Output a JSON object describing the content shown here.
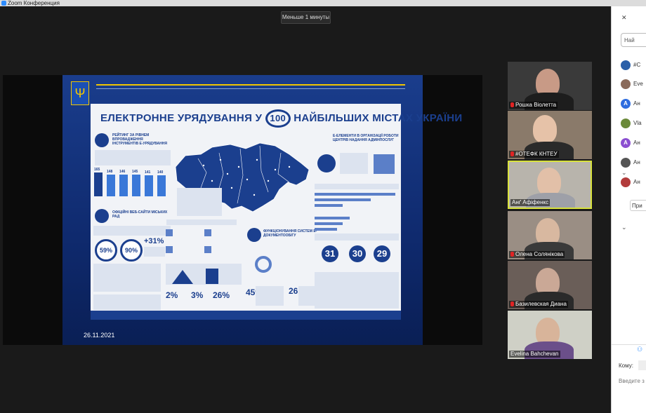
{
  "window": {
    "title": "Zoom Конференция"
  },
  "notice": {
    "label": "Меньше 1 минуты"
  },
  "slide": {
    "title_part1": "ЕЛЕКТРОННЕ УРЯДУВАННЯ У",
    "title_number": "100",
    "title_part2": "НАЙБІЛЬШИХ МІСТАХ УКРАЇНИ",
    "section1": "РЕЙТИНГ ЗА РІВНЕМ ВПРОВАДЖЕННЯ ІНСТРУМЕНТІВ Е-УРЯДУВАННЯ",
    "section2": "ОФІЦІЙНІ ВЕБ-САЙТИ МІСЬКИХ РАД",
    "section3": "ФУНКЦІОНУВАННЯ СИСТЕМ Е-ДОКУМЕНТООБІГУ",
    "section4": "Е-ЕЛЕМЕНТИ В ОРГАНІЗАЦІЇ РОБОТИ ЦЕНТРІВ НАДАННЯ АДМІНПОСЛУГ",
    "bars": [
      "165",
      "148",
      "146",
      "145",
      "141",
      "140"
    ],
    "pct1": "59%",
    "pct2": "90%",
    "pct3": "+31%",
    "stats": [
      "2%",
      "3%",
      "26%",
      "45%",
      "26"
    ],
    "circles": [
      "31",
      "30",
      "29"
    ],
    "date": "26.11.2021",
    "coat_glyph": "Ψ"
  },
  "participants": [
    {
      "name": "Рошка Віолетта",
      "muted": true
    },
    {
      "name": "#ОТЕФК КНТЕУ",
      "muted": true
    },
    {
      "name": "Анґ Афіфенкс",
      "muted": false,
      "active": true
    },
    {
      "name": "Олена Солянікова",
      "muted": true
    },
    {
      "name": "Базилевская Диана",
      "muted": true
    },
    {
      "name": "Evelina Bahchevan",
      "muted": false
    }
  ],
  "panel": {
    "close": "✕",
    "search_placeholder": "Най",
    "list": [
      {
        "label": "#С",
        "color": "#2a5fa8"
      },
      {
        "label": "Eve",
        "color": "#8a6a5a"
      },
      {
        "label": "Ан",
        "initial": "А",
        "color": "#2d6cdf"
      },
      {
        "label": "Vla",
        "color": "#6b8a3a"
      },
      {
        "label": "Ан",
        "initial": "А",
        "color": "#8b4fd1"
      },
      {
        "label": "Ан",
        "color": "#555"
      },
      {
        "label": "Ан",
        "color": "#b23b3b"
      }
    ],
    "button": "При",
    "to_label": "Кому:",
    "entry_placeholder": "Введите з"
  }
}
